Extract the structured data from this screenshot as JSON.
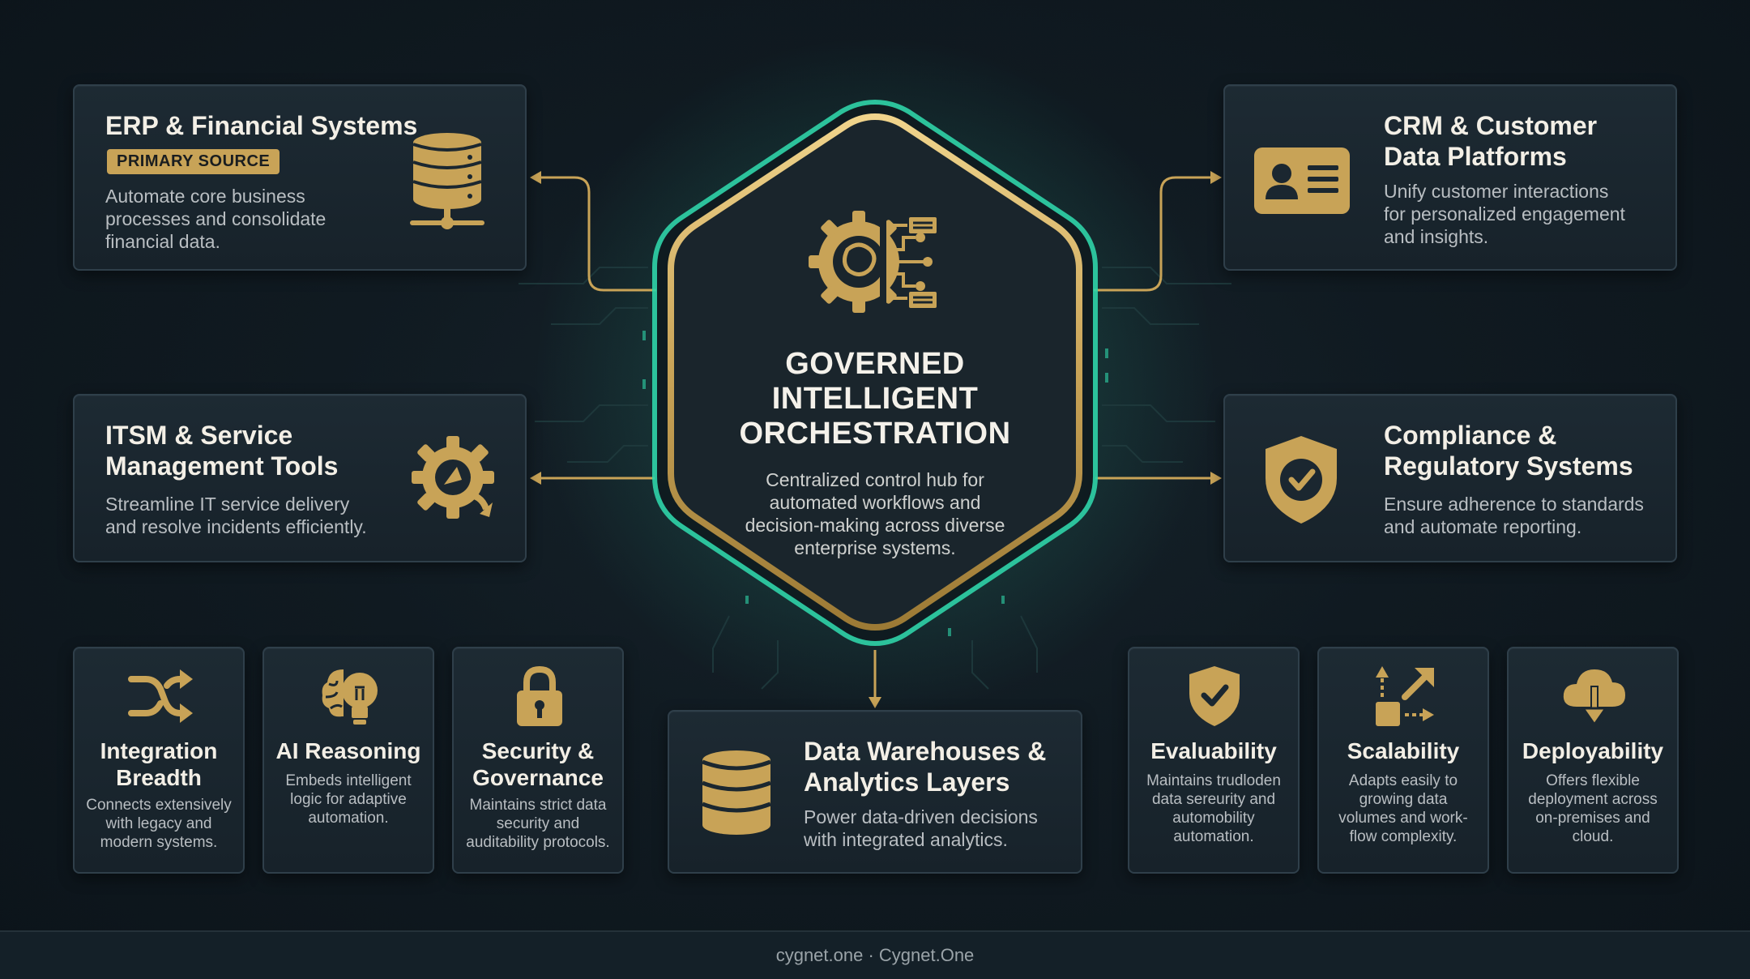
{
  "hub": {
    "title_line1": "GOVERNED",
    "title_line2": "INTELLIGENT",
    "title_line3": "ORCHESTRATION",
    "desc_line1": "Centralized control hub for",
    "desc_line2": "automated workflows and",
    "desc_line3": "decision-making across diverse",
    "desc_line4": "enterprise systems.",
    "icon": "gear-brain-circuit-icon"
  },
  "systems": {
    "erp": {
      "title": "ERP & Financial Systems",
      "badge": "PRIMARY SOURCE",
      "desc_line1": "Automate core business",
      "desc_line2": "processes and consolidate",
      "desc_line3": "financial data.",
      "icon": "database-server-icon"
    },
    "crm": {
      "title_line1": "CRM & Customer",
      "title_line2": "Data Platforms",
      "desc_line1": "Unify customer interactions",
      "desc_line2": "for personalized engagement",
      "desc_line3": "and insights.",
      "icon": "id-card-icon"
    },
    "itsm": {
      "title_line1": "ITSM & Service",
      "title_line2": "Management Tools",
      "desc_line1": "Streamline IT service delivery",
      "desc_line2": "and resolve incidents efficiently.",
      "icon": "gear-refresh-icon"
    },
    "compliance": {
      "title_line1": "Compliance &",
      "title_line2": "Regulatory Systems",
      "desc_line1": "Ensure adherence to standards",
      "desc_line2": "and automate reporting.",
      "icon": "shield-check-icon"
    },
    "warehouse": {
      "title_line1": "Data Warehouses &",
      "title_line2": "Analytics Layers",
      "desc_line1": "Power data-driven decisions",
      "desc_line2": "with integrated analytics.",
      "icon": "database-icon"
    }
  },
  "capabilities": [
    {
      "title_line1": "Integration",
      "title_line2": "Breadth",
      "desc_line1": "Connects extensively",
      "desc_line2": "with legacy and",
      "desc_line3": "modern systems.",
      "icon": "shuffle-icon"
    },
    {
      "title_line1": "AI Reasoning",
      "title_line2": "",
      "desc_line1": "Embeds intelligent",
      "desc_line2": "logic for adaptive",
      "desc_line3": "automation.",
      "icon": "brain-bulb-icon"
    },
    {
      "title_line1": "Security &",
      "title_line2": "Governance",
      "desc_line1": "Maintains strict data",
      "desc_line2": "security and",
      "desc_line3": "auditability protocols.",
      "icon": "padlock-icon"
    },
    {
      "title_line1": "Evaluability",
      "title_line2": "",
      "desc_line1": "Maintains trudloden",
      "desc_line2": "data sereurity and",
      "desc_line3": "automobility",
      "desc_line4": "automation.",
      "icon": "shield-check-icon"
    },
    {
      "title_line1": "Scalability",
      "title_line2": "",
      "desc_line1": "Adapts easily to",
      "desc_line2": "growing data",
      "desc_line3": "volumes and work-",
      "desc_line4": "flow complexity.",
      "icon": "scale-arrows-icon"
    },
    {
      "title_line1": "Deployability",
      "title_line2": "",
      "desc_line1": "Offers flexible",
      "desc_line2": "deployment across",
      "desc_line3": "on-premises and",
      "desc_line4": "cloud.",
      "icon": "cloud-download-icon"
    }
  ],
  "footer": {
    "text": "cygnet.one · Cygnet.One"
  },
  "colors": {
    "gold": "#c8a357",
    "teal": "#2fd3a8",
    "card": "#1b2730",
    "border": "#2f3f4a"
  }
}
